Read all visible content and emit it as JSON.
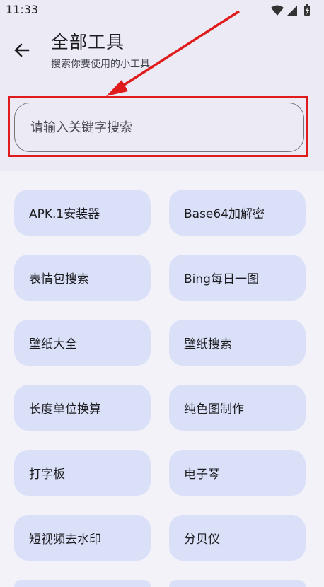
{
  "status_bar": {
    "time": "11:33"
  },
  "header": {
    "title": "全部工具",
    "subtitle": "搜索你要使用的小工具"
  },
  "search": {
    "placeholder": "请输入关键字搜索",
    "value": ""
  },
  "colors": {
    "accent_red": "#e01b1b",
    "tile_bg": "#d9e0f8",
    "header_bg": "#eceaf4"
  },
  "tools": [
    "APK.1安装器",
    "Base64加解密",
    "表情包搜索",
    "Bing每日一图",
    "壁纸大全",
    "壁纸搜索",
    "长度单位换算",
    "纯色图制作",
    "打字板",
    "电子琴",
    "短视频去水印",
    "分贝仪"
  ]
}
